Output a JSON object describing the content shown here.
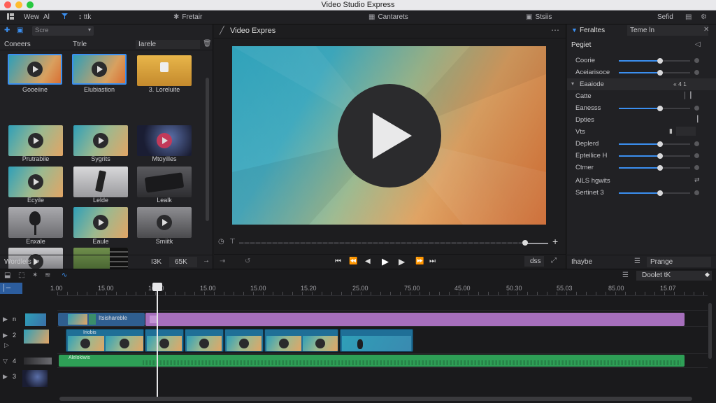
{
  "window": {
    "title": "Video Studio Express"
  },
  "menubar": {
    "view_label": "Wew",
    "all_label": "Al",
    "edit_label": "↕ ttk",
    "freeform_label": "Fretair",
    "contents_label": "Cantarets",
    "studio_label": "Stsiis",
    "settings_label": "Sefid"
  },
  "library": {
    "filter_placeholder": "Scre",
    "columns": [
      "Coneers",
      "Ttrle",
      "Iarele"
    ],
    "items": [
      {
        "label": "Gooeiine"
      },
      {
        "label": "Elubiastion"
      },
      {
        "label": "3. Loreluite"
      },
      {
        "label": "Prutrabile"
      },
      {
        "label": "Sygrits"
      },
      {
        "label": "Mtoyilles"
      },
      {
        "label": "Ecyile"
      },
      {
        "label": "Lelde"
      },
      {
        "label": "Lealk"
      },
      {
        "label": "Enxale"
      },
      {
        "label": "Eaule"
      },
      {
        "label": "Smiitk"
      },
      {
        "label": ""
      },
      {
        "label": ""
      }
    ],
    "bottom": {
      "label": "Wordlels",
      "left_value": "I3K",
      "right_value": "65K"
    }
  },
  "viewer": {
    "tab_title": "Video Expres",
    "transport_right": "dss"
  },
  "inspector": {
    "tab_active": "Feraltes",
    "tab_other": "Teme ln",
    "section_title": "Pegiet",
    "rows": [
      {
        "label": "Coorie",
        "value": 0.48
      },
      {
        "label": "Aceiarisoce",
        "value": 0.48
      },
      {
        "label": "Eaaiode",
        "value": null,
        "badge": "« 4 1"
      },
      {
        "label": "Catte",
        "value": null
      },
      {
        "label": "Eanesss",
        "value": 0.48
      },
      {
        "label": "Dpties",
        "value": null
      },
      {
        "label": "Vts",
        "value": null
      },
      {
        "label": "Deplerd",
        "value": 0.48
      },
      {
        "label": "Epteilice H",
        "value": 0.48
      },
      {
        "label": "Ctmer",
        "value": 0.48
      },
      {
        "label": "AlLS hgwits",
        "value": null
      },
      {
        "label": "Sertinet 3",
        "value": 0.48
      }
    ],
    "bottom_left": "Ihaybe",
    "bottom_right": "Prange"
  },
  "timeline": {
    "dropdown": "Doolet tK",
    "ruler": [
      "1.00",
      "15.00",
      "10.00",
      "15.00",
      "15.00",
      "15.20",
      "25.00",
      "75.00",
      "45.00",
      "50.30",
      "55.03",
      "85.00",
      "15.07"
    ],
    "tracks": [
      {
        "label": "n",
        "clip_text": "Itsishareble"
      },
      {
        "label": "2",
        "clip_text": "Iriobis"
      },
      {
        "label": "4",
        "clip_text": "Alelokiwis"
      },
      {
        "label": "3",
        "clip_text": ""
      }
    ]
  },
  "colors": {
    "accent": "#3b8ff0",
    "clip_purple": "#a66fbc",
    "clip_green": "#2e9f56",
    "clip_blue": "#1f6f97"
  }
}
